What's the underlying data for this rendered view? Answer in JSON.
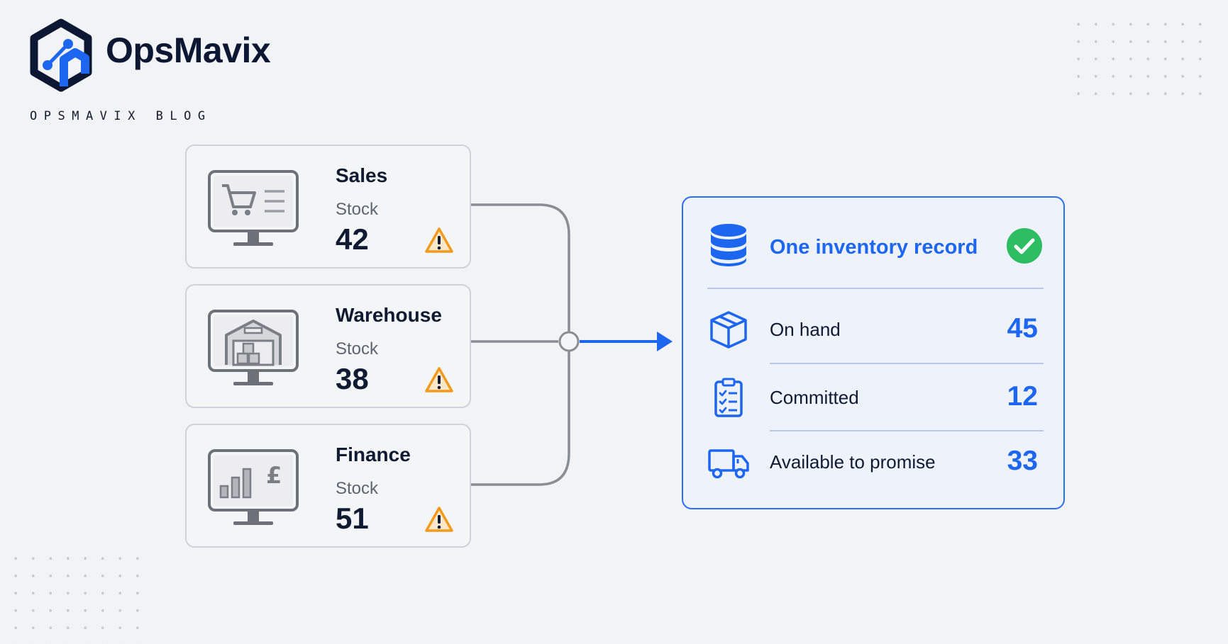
{
  "brand": {
    "name": "OpsMavix",
    "tagline": "OPSMAVIX BLOG"
  },
  "sources": [
    {
      "title": "Sales",
      "label": "Stock",
      "value": "42"
    },
    {
      "title": "Warehouse",
      "label": "Stock",
      "value": "38"
    },
    {
      "title": "Finance",
      "label": "Stock",
      "value": "51"
    }
  ],
  "record": {
    "title": "One inventory record",
    "rows": [
      {
        "label": "On hand",
        "value": "45"
      },
      {
        "label": "Committed",
        "value": "12"
      },
      {
        "label": "Available to promise",
        "value": "33"
      }
    ]
  },
  "colors": {
    "accent": "#1d66f0",
    "navy": "#0c1733",
    "warning": "#f29a1d",
    "success": "#2dbd63",
    "muted": "#8a8d94"
  },
  "icons": {
    "logo": "opsmavix-hexagon-logo",
    "sources": [
      "shopping-cart-monitor-icon",
      "warehouse-monitor-icon",
      "finance-chart-monitor-icon"
    ],
    "warning": "warning-triangle-icon",
    "record": "database-icon",
    "status": "check-circle-icon",
    "rows": [
      "package-box-icon",
      "clipboard-checklist-icon",
      "delivery-truck-icon"
    ]
  }
}
